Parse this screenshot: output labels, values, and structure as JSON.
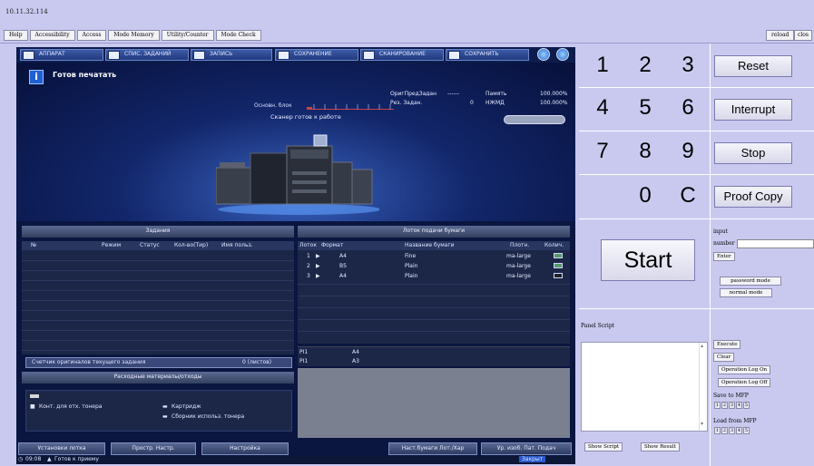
{
  "window": {
    "ip": "10.11.32.114"
  },
  "menubar": {
    "items": [
      "Help",
      "Accessibility",
      "Access",
      "Mode Memory",
      "Utility/Counter",
      "Mode Check"
    ],
    "reload": "reload",
    "close": "clos"
  },
  "mfp": {
    "tabs": [
      "АППАРАТ",
      "СПИС. ЗАДАНИЙ",
      "ЗАПИСЬ",
      "СОХРАНЕНИЕ",
      "СКАНИРОВАНИЕ",
      "СОХРАНИТЬ"
    ],
    "status": {
      "ready": "Готов печатать",
      "basic_label": "Основн. блок",
      "scanner": "Сканер готов к работе",
      "stats": [
        {
          "label": "ОригПредЗадан",
          "value": "------"
        },
        {
          "label": "Память",
          "value": "100.000%"
        },
        {
          "label": "Рез. Задан.",
          "value": "0"
        },
        {
          "label": "НЖМД",
          "value": "100.000%"
        }
      ]
    },
    "jobs": {
      "title": "Задания",
      "columns": [
        "№",
        "Режим",
        "Статус",
        "Кол-во(Тир)",
        "Имя польз."
      ],
      "footer_label": "Счетчик оригиналов текущего задания",
      "footer_value": "0 (листов)"
    },
    "consumables": {
      "title": "Расходные материалы/отходы",
      "items": [
        "Конт. для отх. тонера",
        "Картридж",
        "Сборник использ. тонера"
      ]
    },
    "trays": {
      "title": "Лоток подачи бумаги",
      "columns": [
        "Лоток",
        "Формат",
        "Название бумаги",
        "Плотн.",
        "Колич."
      ],
      "rows": [
        {
          "tray": "1",
          "size": "A4",
          "name": "Fine",
          "weight": "ma-large"
        },
        {
          "tray": "2",
          "size": "B5",
          "name": "Plain",
          "weight": "ma-large"
        },
        {
          "tray": "3",
          "size": "A4",
          "name": "Plain",
          "weight": "ma-large"
        }
      ],
      "pi": [
        {
          "label": "PI1",
          "size": "A4"
        },
        {
          "label": "PI1",
          "size": "A3"
        }
      ]
    },
    "bottom_buttons": [
      "Установки лотка",
      "Простр. Настр.",
      "Настройка",
      "Наст.бумаги Лот./Хар",
      "Ур. изоб. Пат. Подач"
    ],
    "statusbar": {
      "time": "09:08",
      "text": "Готов к приему",
      "right": "Закрыт"
    }
  },
  "keypad": {
    "digits": [
      "1",
      "2",
      "3",
      "4",
      "5",
      "6",
      "7",
      "8",
      "9",
      "0",
      "C"
    ],
    "buttons": {
      "reset": "Reset",
      "interrupt": "Interrupt",
      "stop": "Stop",
      "proof": "Proof Copy",
      "start": "Start"
    }
  },
  "input_panel": {
    "input_label": "input",
    "number_label": "number",
    "enter": "Enter",
    "password_mode": "password mode",
    "normal_mode": "normal mode"
  },
  "script_panel": {
    "title": "Panel Script",
    "execute": "Execute",
    "clear": "Clear",
    "log_on": "Operation Log On",
    "log_off": "Operation Log Off",
    "save_label": "Save to MFP",
    "load_label": "Load from MFP",
    "slots": [
      "1",
      "2",
      "3",
      "4",
      "5"
    ],
    "show_script": "Show Script",
    "show_result": "Show Result"
  }
}
